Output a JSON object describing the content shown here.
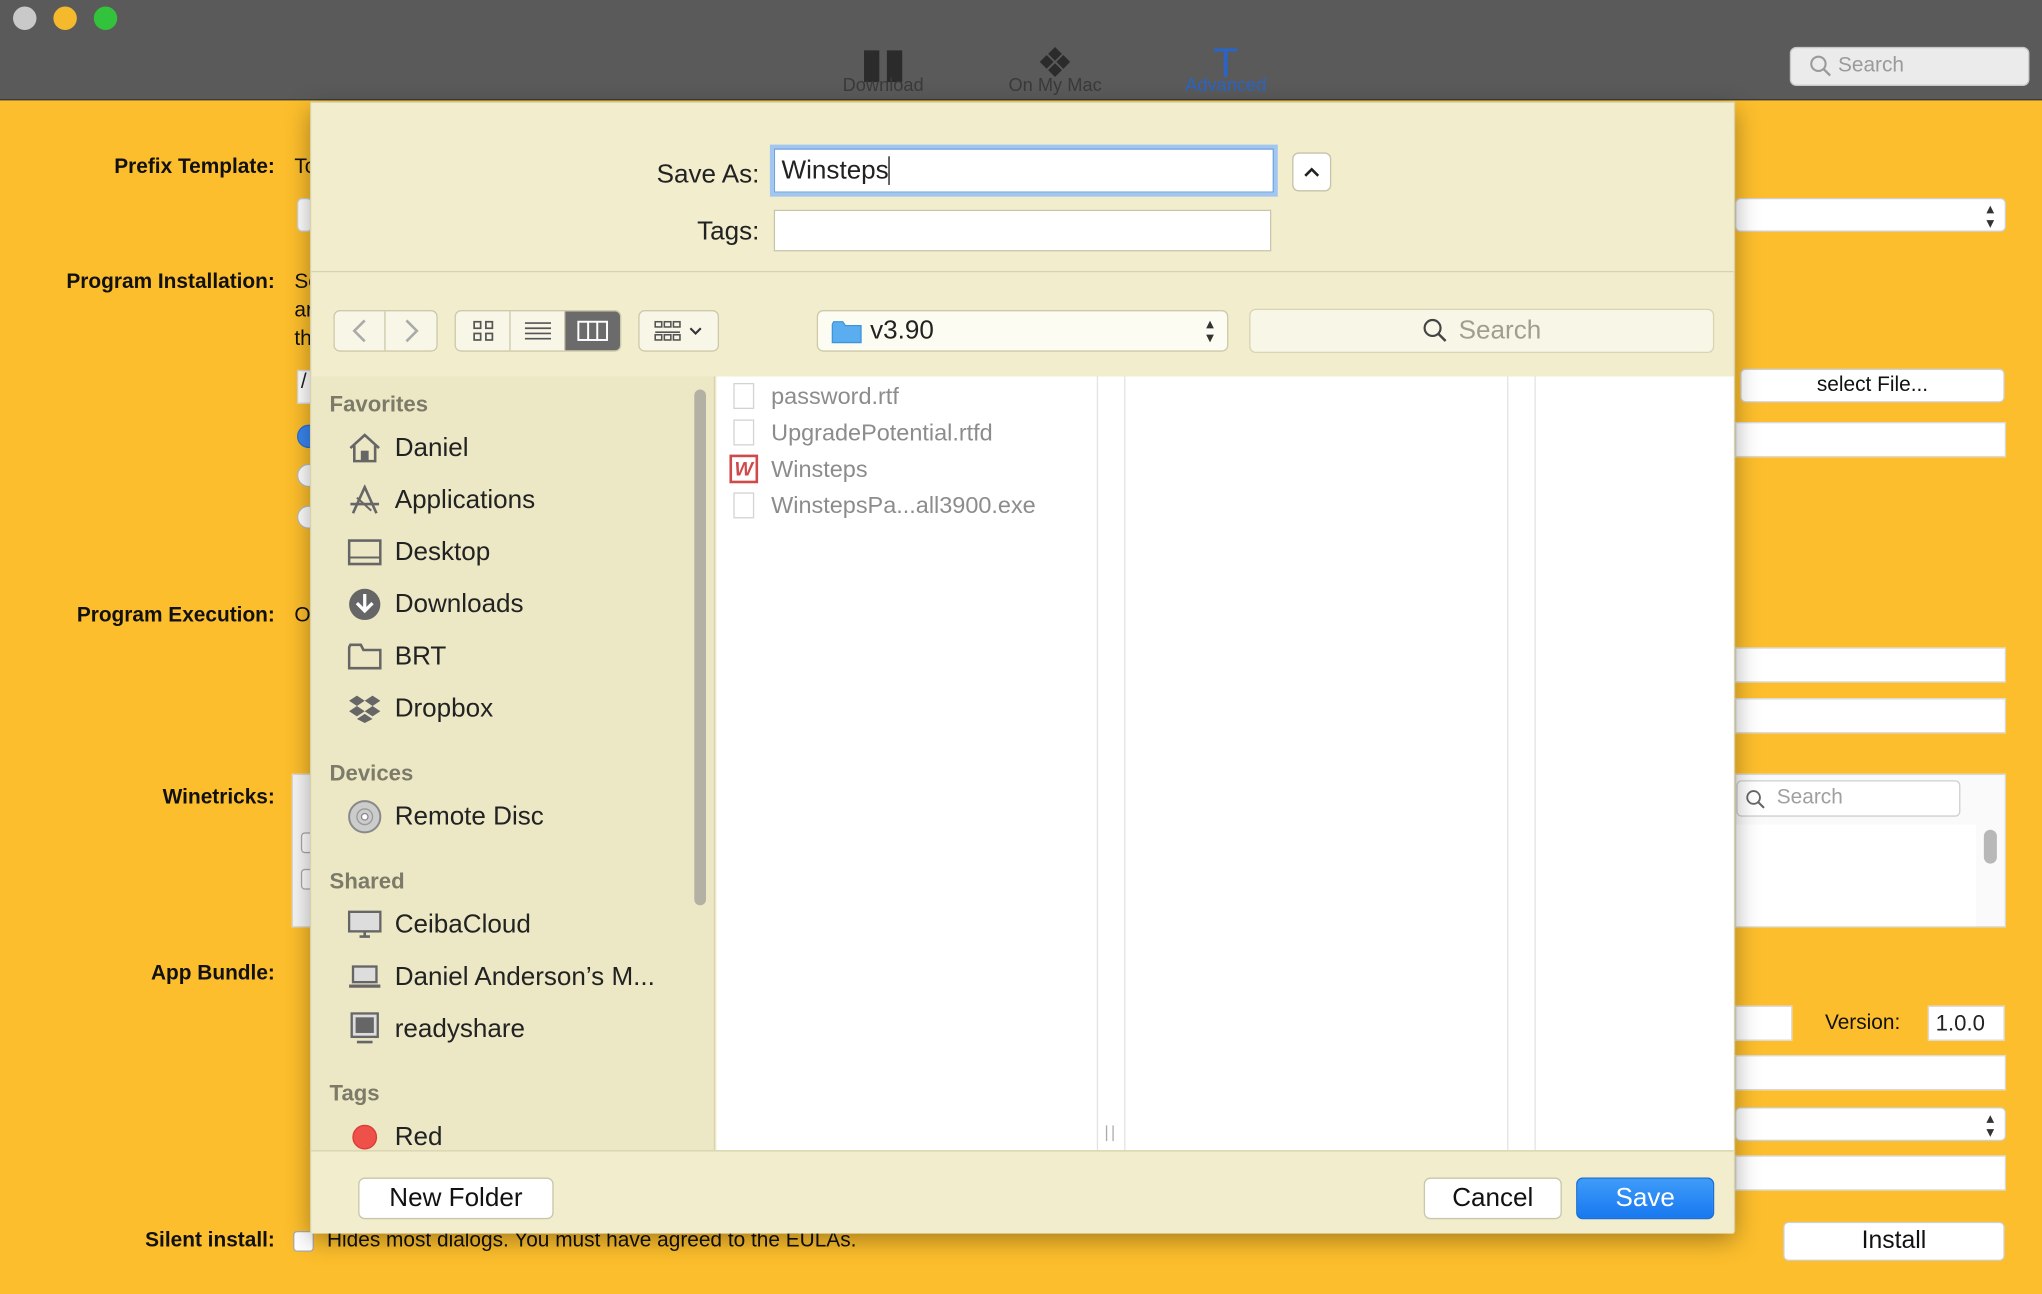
{
  "titlebar": {
    "toolbar_items": [
      "Download",
      "On My Mac",
      "Advanced"
    ],
    "search_placeholder": "Search"
  },
  "form": {
    "prefix_template_label": "Prefix Template:",
    "prefix_template_text": "To",
    "program_installation_label": "Program Installation:",
    "program_installation_text": [
      "Se",
      "ar",
      "th"
    ],
    "path_value": "/",
    "select_file_button": "select File...",
    "program_execution_label": "Program Execution:",
    "program_execution_text": "O",
    "winetricks_label": "Winetricks:",
    "winetricks_search_placeholder": "Search",
    "app_bundle_label": "App Bundle:",
    "version_label": "Version:",
    "version_value": "1.0.0",
    "silent_install_label": "Silent install:",
    "silent_install_text": "Hides most dialogs. You must have agreed to the EULAs.",
    "install_button": "Install"
  },
  "sheet": {
    "save_as_label": "Save As:",
    "save_as_value": "Winsteps",
    "tags_label": "Tags:",
    "tags_value": "",
    "location": "v3.90",
    "search_placeholder": "Search",
    "sidebar": {
      "favorites_header": "Favorites",
      "favorites": [
        {
          "label": "Daniel",
          "icon": "home-icon"
        },
        {
          "label": "Applications",
          "icon": "applications-icon"
        },
        {
          "label": "Desktop",
          "icon": "desktop-icon"
        },
        {
          "label": "Downloads",
          "icon": "downloads-icon"
        },
        {
          "label": "BRT",
          "icon": "folder-icon"
        },
        {
          "label": "Dropbox",
          "icon": "dropbox-icon"
        }
      ],
      "devices_header": "Devices",
      "devices": [
        {
          "label": "Remote Disc",
          "icon": "disc-icon"
        }
      ],
      "shared_header": "Shared",
      "shared": [
        {
          "label": "CeibaCloud",
          "icon": "monitor-icon"
        },
        {
          "label": "Daniel Anderson’s M...",
          "icon": "laptop-icon"
        },
        {
          "label": "readyshare",
          "icon": "server-icon"
        }
      ],
      "tags_header": "Tags",
      "tags": [
        {
          "label": "Red",
          "color": "#f0504a"
        }
      ]
    },
    "files": [
      {
        "name": "password.rtf",
        "icon": "rtf-document-icon"
      },
      {
        "name": "UpgradePotential.rtfd",
        "icon": "rtfd-document-icon"
      },
      {
        "name": "Winsteps",
        "icon": "winsteps-app-icon"
      },
      {
        "name": "WinstepsPa...all3900.exe",
        "icon": "exe-document-icon"
      }
    ],
    "new_folder_button": "New Folder",
    "cancel_button": "Cancel",
    "save_button": "Save",
    "accent_color": "#1878f0"
  }
}
